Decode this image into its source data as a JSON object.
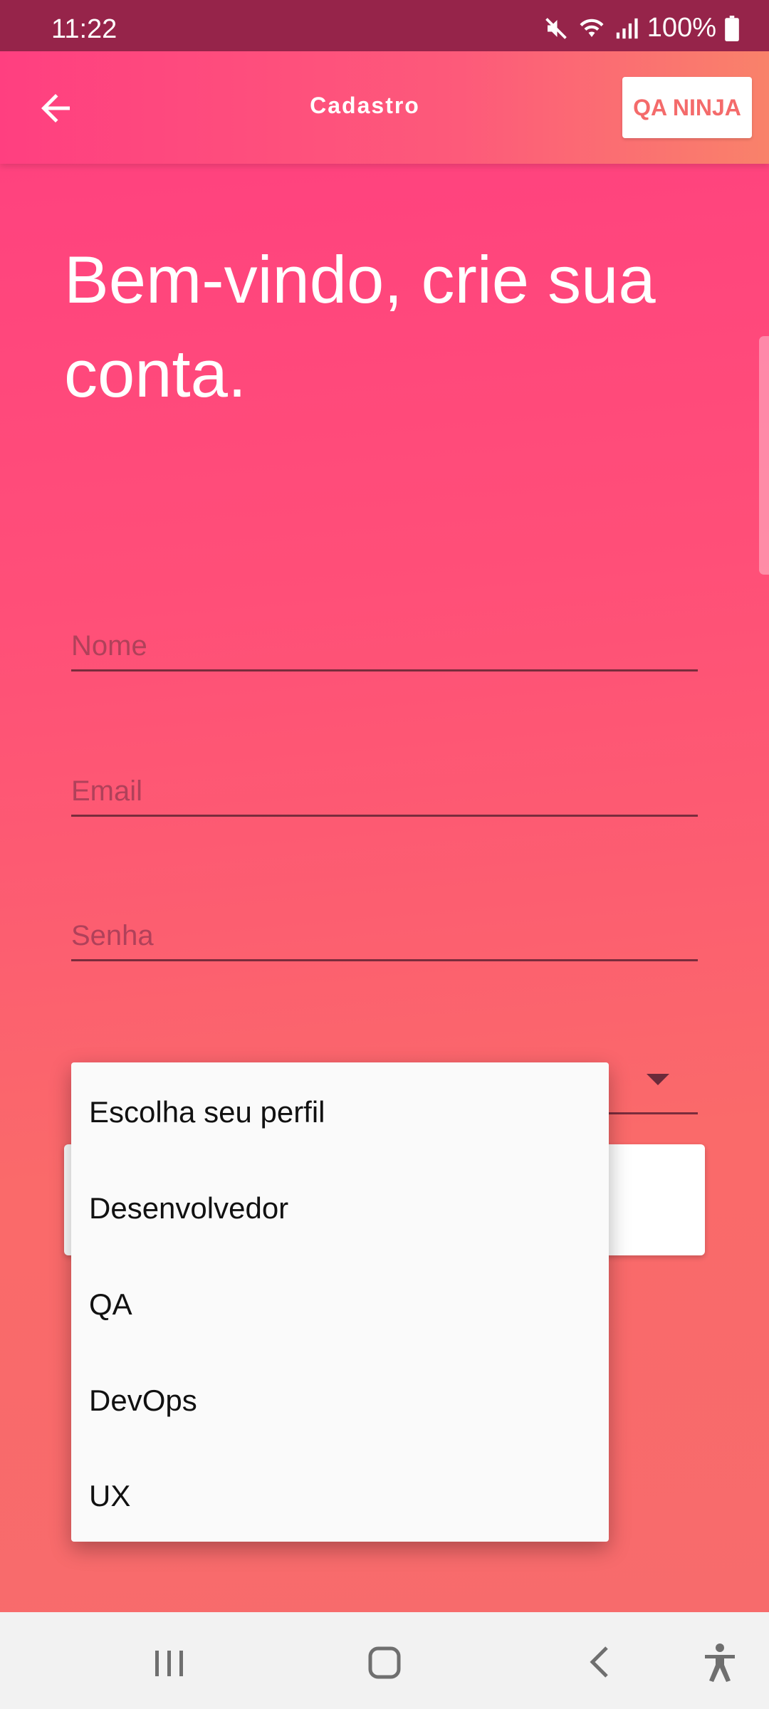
{
  "status_bar": {
    "time": "11:22",
    "battery": "100%"
  },
  "app_bar": {
    "title": "Cadastro",
    "qa_ninja_label": "QA NINJA"
  },
  "welcome_text": "Bem-vindo, crie sua conta.",
  "form": {
    "name_placeholder": "Nome",
    "email_placeholder": "Email",
    "password_placeholder": "Senha"
  },
  "profile_menu": {
    "items": [
      "Escolha seu perfil",
      "Desenvolvedor",
      "QA",
      "DevOps",
      "UX"
    ]
  },
  "icons": {
    "back": "arrow-left-icon",
    "mute": "mute-icon",
    "wifi": "wifi-icon",
    "signal": "signal-icon",
    "battery": "battery-icon",
    "recents": "recents-icon",
    "home": "home-icon",
    "nav_back": "chevron-left-icon",
    "accessibility": "accessibility-icon"
  },
  "colors": {
    "status_bar": "#96244a",
    "accent": "#ff3f80",
    "accent_secondary": "#f76b6c"
  }
}
